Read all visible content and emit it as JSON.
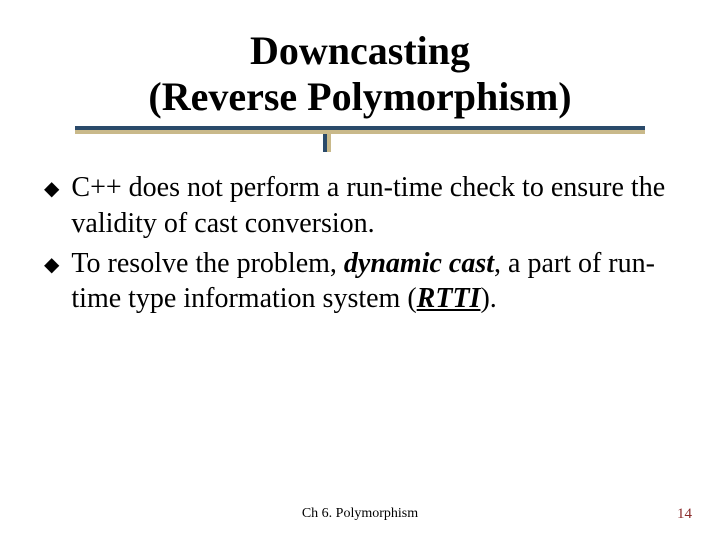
{
  "title": {
    "line1": "Downcasting",
    "line2": "(Reverse Polymorphism)"
  },
  "bullets": [
    {
      "pre": "C++ does not perform a run-time check to ensure the validity of cast conversion."
    },
    {
      "pre": "To resolve the problem, ",
      "em1": "dynamic cast",
      "mid": ", a part of run-time type information system (",
      "em2": "RTTI",
      "post": ")."
    }
  ],
  "footer": {
    "center": "Ch 6. Polymorphism",
    "page": "14"
  }
}
